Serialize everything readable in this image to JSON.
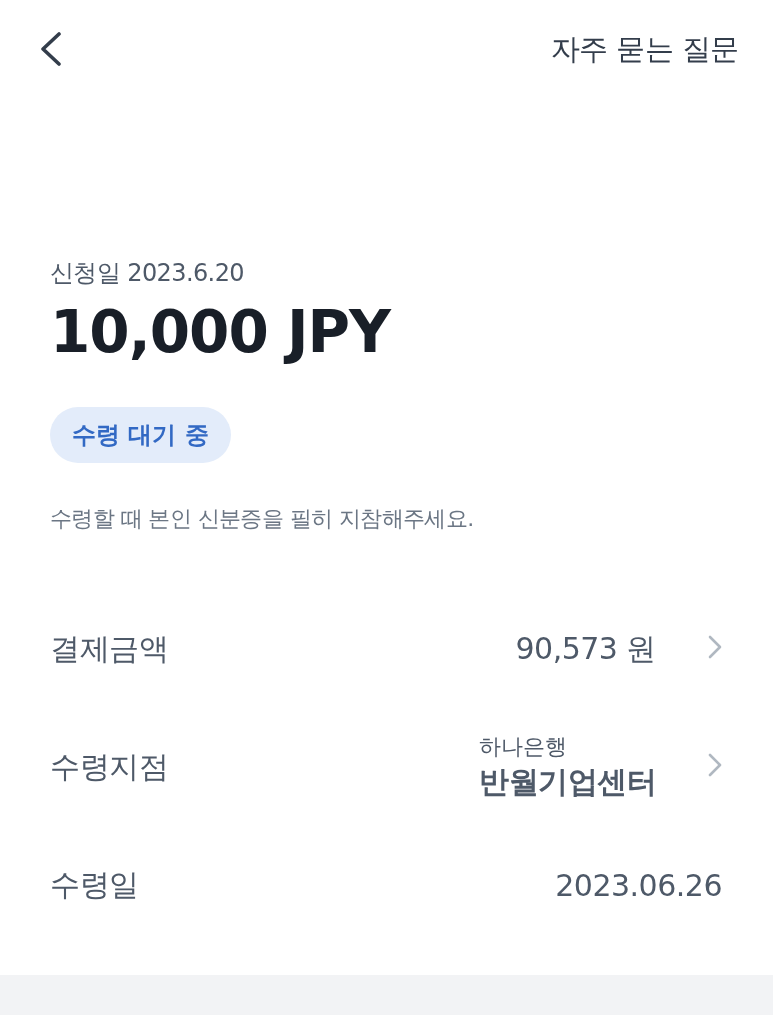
{
  "header": {
    "title": "자주 묻는 질문"
  },
  "summary": {
    "request_date": "신청일 2023.6.20",
    "amount": "10,000 JPY",
    "status": "수령 대기 중",
    "note": "수령할 때 본인 신분증을 필히 지참해주세요."
  },
  "details": [
    {
      "kind": "link",
      "label": "결제금액",
      "value": "90,573 원"
    },
    {
      "kind": "branch",
      "label": "수령지점",
      "bank": "하나은행",
      "value": "반월기업센터"
    },
    {
      "kind": "plain",
      "label": "수령일",
      "value": "2023.06.26"
    }
  ]
}
